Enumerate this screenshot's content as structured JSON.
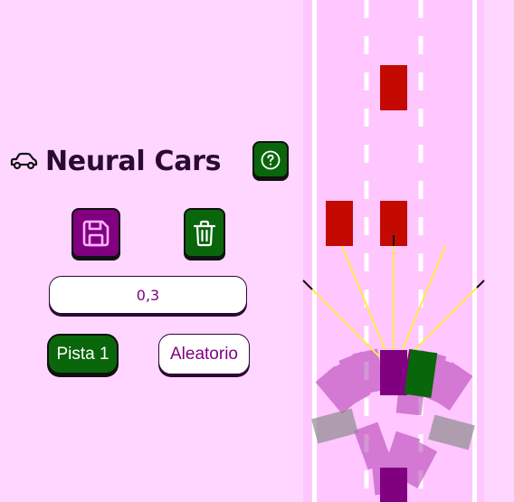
{
  "app": {
    "title": "Neural Cars",
    "title_icon": "car-outline-icon"
  },
  "controls": {
    "help_icon": "question-circle-icon",
    "save_icon": "floppy-disk-icon",
    "delete_icon": "trash-icon",
    "mutation_value": "0,3",
    "track_button_label": "Pista 1",
    "random_button_label": "Aleatorio"
  },
  "colors": {
    "background": "#ffd6ff",
    "road": "#ffc6ff",
    "primary_green": "#0a660a",
    "primary_purple": "#800080",
    "traffic_car": "#cc0000",
    "sensor": "#ffe94d",
    "crashed_car": "#8c8c8c"
  }
}
